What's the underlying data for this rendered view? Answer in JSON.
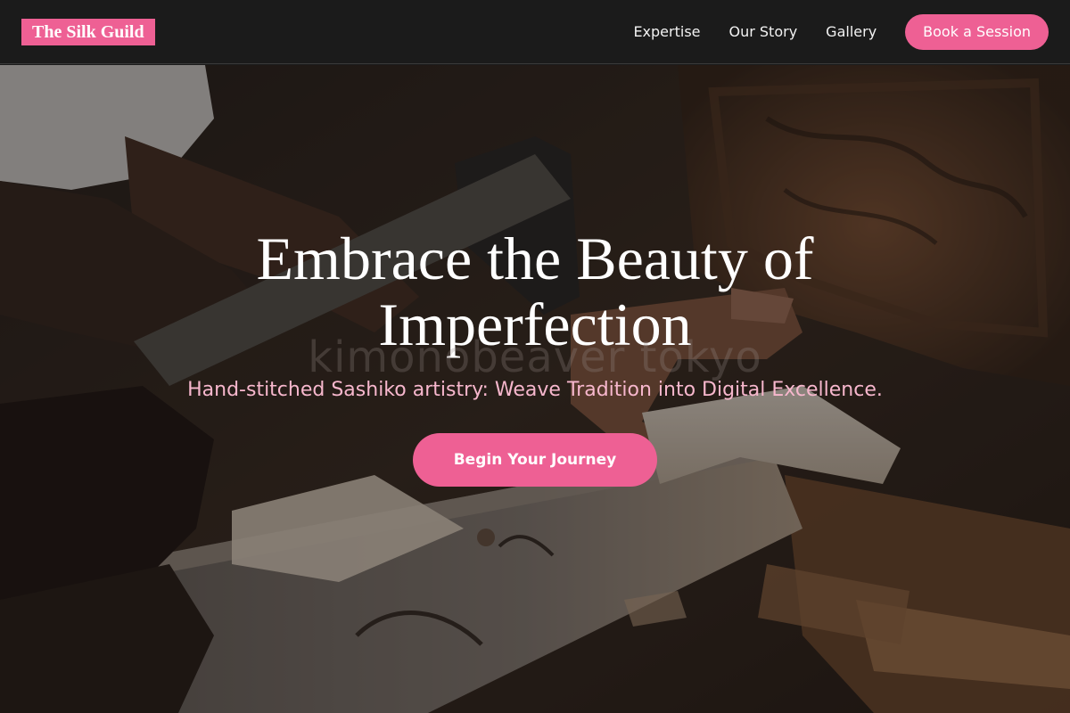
{
  "brand": {
    "name": "The Silk Guild"
  },
  "nav": {
    "links": [
      {
        "label": "Expertise"
      },
      {
        "label": "Our Story"
      },
      {
        "label": "Gallery"
      }
    ],
    "cta_label": "Book a Session"
  },
  "hero": {
    "headline": "Embrace the Beauty of Imperfection",
    "watermark": "kimonobeaver tokyo",
    "subtitle": "Hand-stitched Sashiko artistry: Weave Tradition into Digital Excellence.",
    "cta_label": "Begin Your Journey"
  },
  "colors": {
    "accent": "#ee6094",
    "nav_background": "#1b1b1b",
    "subtitle": "#f7b7cd"
  }
}
